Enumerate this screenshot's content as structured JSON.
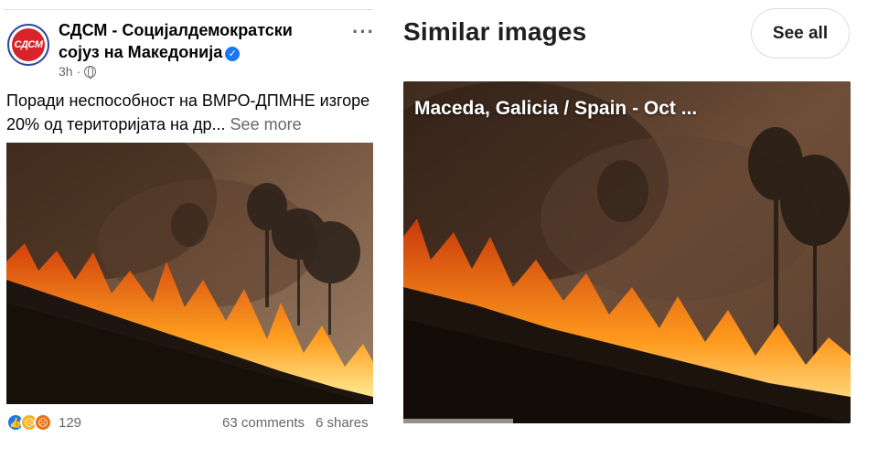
{
  "post": {
    "avatar_text": "СДСМ",
    "page_name": "СДСМ - Социјалдемократски сојуз на Македонија",
    "time": "3h",
    "text": "Поради неспособност на ВМРО-ДПМНЕ изгоре 20% од територијата на др...",
    "see_more": "See more",
    "reaction_count": "129",
    "comments": "63 comments",
    "shares": "6 shares"
  },
  "similar": {
    "title": "Similar images",
    "see_all": "See all",
    "caption": "Maceda, Galicia / Spain - Oct ..."
  },
  "colors": {
    "facebook_blue": "#1877f2",
    "brand_red": "#d8232a",
    "fire_orange": "#ff8a1a"
  }
}
